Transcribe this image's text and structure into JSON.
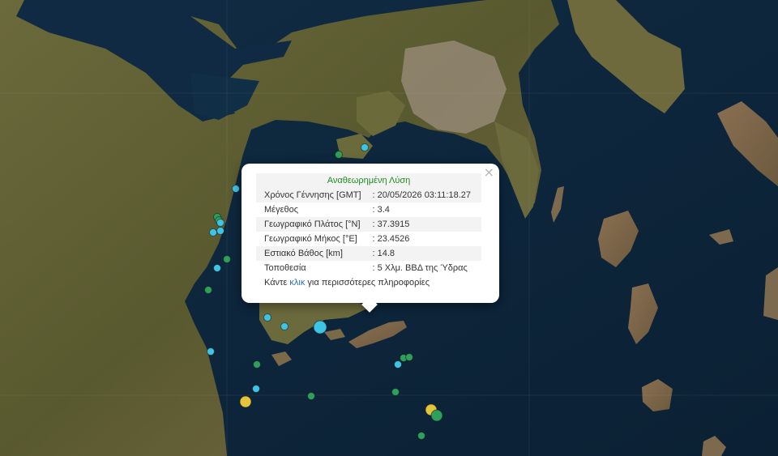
{
  "colors": {
    "sea": "#0d2438",
    "land": "#5b5a34",
    "popup_title": "#228b22",
    "link": "#2a6fb5",
    "quake_green": "#2ea05b",
    "quake_cyan": "#3ec5e6",
    "quake_yellow": "#e3c43a"
  },
  "icons": {
    "close": "close-icon"
  },
  "quakes": [
    {
      "category": "green",
      "magnitude_class": "small"
    },
    {
      "category": "cyan",
      "magnitude_class": "small"
    },
    {
      "category": "cyan",
      "magnitude_class": "small"
    },
    {
      "category": "green",
      "magnitude_class": "small"
    },
    {
      "category": "green",
      "magnitude_class": "small"
    },
    {
      "category": "cyan",
      "magnitude_class": "small"
    },
    {
      "category": "cyan",
      "magnitude_class": "small"
    },
    {
      "category": "cyan",
      "magnitude_class": "small"
    },
    {
      "category": "green",
      "magnitude_class": "small"
    },
    {
      "category": "cyan",
      "magnitude_class": "small"
    },
    {
      "category": "green",
      "magnitude_class": "small"
    },
    {
      "category": "cyan",
      "magnitude_class": "small"
    },
    {
      "category": "cyan",
      "magnitude_class": "small"
    },
    {
      "category": "cyan",
      "magnitude_class": "large"
    },
    {
      "category": "cyan",
      "magnitude_class": "small"
    },
    {
      "category": "green",
      "magnitude_class": "small"
    },
    {
      "category": "cyan",
      "magnitude_class": "small"
    },
    {
      "category": "yellow",
      "magnitude_class": "medium"
    },
    {
      "category": "green",
      "magnitude_class": "small"
    },
    {
      "category": "green",
      "magnitude_class": "small"
    },
    {
      "category": "green",
      "magnitude_class": "small"
    },
    {
      "category": "cyan",
      "magnitude_class": "small"
    },
    {
      "category": "green",
      "magnitude_class": "small"
    },
    {
      "category": "yellow",
      "magnitude_class": "medium"
    },
    {
      "category": "green",
      "magnitude_class": "medium"
    },
    {
      "category": "green",
      "magnitude_class": "small"
    }
  ],
  "popup": {
    "title": "Αναθεωρημένη Λύση",
    "rows": [
      {
        "label": "Χρόνος Γέννησης [GMT]",
        "value": ": 20/05/2026 03:11:18.27"
      },
      {
        "label": "Μέγεθος",
        "value": ": 3.4"
      },
      {
        "label": "Γεωγραφικό Πλάτος [°N]",
        "value": ": 37.3915"
      },
      {
        "label": "Γεωγραφικό Μήκος [°E]",
        "value": ": 23.4526"
      },
      {
        "label": "Εστιακό Βάθος [km]",
        "value": ": 14.8"
      },
      {
        "label": "Τοποθεσία",
        "value": ": 5 Χλμ. ΒΒΔ της Ύδρας"
      }
    ],
    "more_prefix": "Κάντε",
    "more_link": "κλικ",
    "more_suffix": "για περισσότερες πληροφορίες"
  }
}
